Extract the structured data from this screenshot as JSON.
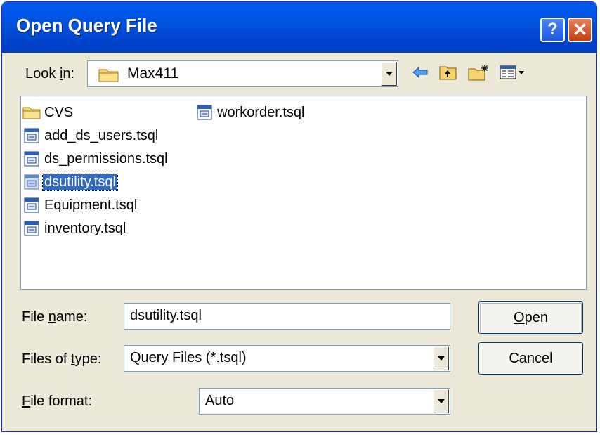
{
  "window": {
    "title": "Open Query File"
  },
  "title_buttons": {
    "help": "?",
    "close": "✕"
  },
  "look_in": {
    "label_pre": "Look ",
    "label_key": "i",
    "label_post": "n:",
    "value": "Max411"
  },
  "toolbar": {
    "icons": [
      "back-arrow-icon",
      "up-folder-icon",
      "new-folder-icon",
      "view-menu-icon"
    ]
  },
  "files": [
    {
      "name": "CVS",
      "type": "folder"
    },
    {
      "name": "add_ds_users.tsql",
      "type": "tsql"
    },
    {
      "name": "ds_permissions.tsql",
      "type": "tsql"
    },
    {
      "name": "dsutility.tsql",
      "type": "tsql",
      "selected": true
    },
    {
      "name": "Equipment.tsql",
      "type": "tsql"
    },
    {
      "name": "inventory.tsql",
      "type": "tsql"
    },
    {
      "name": "workorder.tsql",
      "type": "tsql"
    }
  ],
  "form": {
    "file_name": {
      "label_pre": "File ",
      "label_key": "n",
      "label_post": "ame:",
      "value": "dsutility.tsql"
    },
    "file_type": {
      "label_pre": "Files of ",
      "label_key": "t",
      "label_post": "ype:",
      "value": "Query Files (*.tsql)"
    },
    "file_format": {
      "label_pre": "",
      "label_key": "F",
      "label_post": "ile format:",
      "value": "Auto"
    }
  },
  "buttons": {
    "open": {
      "key": "O",
      "rest": "pen"
    },
    "cancel": "Cancel"
  },
  "colors": {
    "title_bar": "#0054e3",
    "selection": "#316ac5",
    "dialog_bg": "#ece9d8"
  }
}
